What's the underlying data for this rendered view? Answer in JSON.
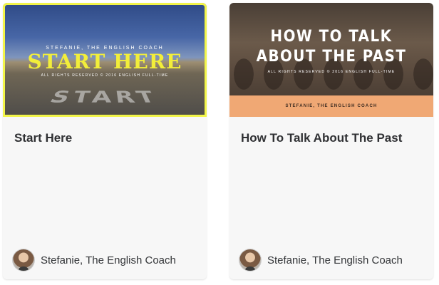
{
  "cards": [
    {
      "title": "Start Here",
      "thumbnail": {
        "author": "Stefanie, The English Coach",
        "headline": "Start Here",
        "rights": "All rights reserved © 2016 English Full-time",
        "road_word": "START",
        "accent_color": "#f2ee3a"
      },
      "author": "Stefanie, The English Coach"
    },
    {
      "title": "How To Talk About The Past",
      "thumbnail": {
        "headline_line1": "How To Talk",
        "headline_line2": "About The Past",
        "rights": "All rights reserved © 2016 English Full-time",
        "band_text": "Stefanie, The English Coach",
        "band_color": "#f0a874"
      },
      "author": "Stefanie, The English Coach"
    }
  ]
}
